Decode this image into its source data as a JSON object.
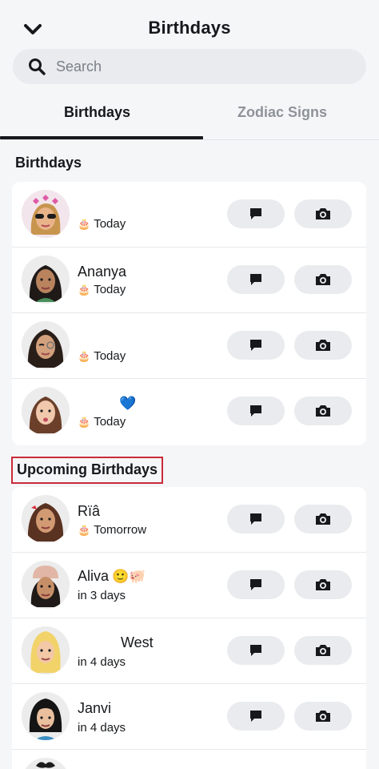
{
  "header": {
    "title": "Birthdays"
  },
  "search": {
    "placeholder": "Search"
  },
  "tabs": [
    {
      "label": "Birthdays",
      "active": true
    },
    {
      "label": "Zodiac Signs",
      "active": false
    }
  ],
  "sections": {
    "birthdays_title": "Birthdays",
    "upcoming_title": "Upcoming Birthdays"
  },
  "birthdays": [
    {
      "name": "",
      "when": "Today"
    },
    {
      "name": "Ananya",
      "when": "Today"
    },
    {
      "name": "",
      "when": "Today"
    },
    {
      "name": "",
      "name_emoji": "💙",
      "when": "Today"
    }
  ],
  "upcoming": [
    {
      "name": "Rïâ",
      "when": "Tomorrow"
    },
    {
      "name": "Aliva",
      "name_emoji": "🙂🐖",
      "when": "in 3 days"
    },
    {
      "name": "West",
      "when": "in 4 days"
    },
    {
      "name": "Janvi",
      "when": "in 4 days"
    }
  ],
  "icons": {
    "back": "chevron-down-icon",
    "search": "search-icon",
    "chat": "chat-bubble-icon",
    "camera": "camera-icon",
    "cake": "birthday-cake-icon"
  },
  "colors": {
    "background": "#f5f6f8",
    "card": "#ffffff",
    "pill": "#e9ebee",
    "text": "#16191c",
    "muted": "#8e939a",
    "highlight_border": "#c92b3a"
  }
}
